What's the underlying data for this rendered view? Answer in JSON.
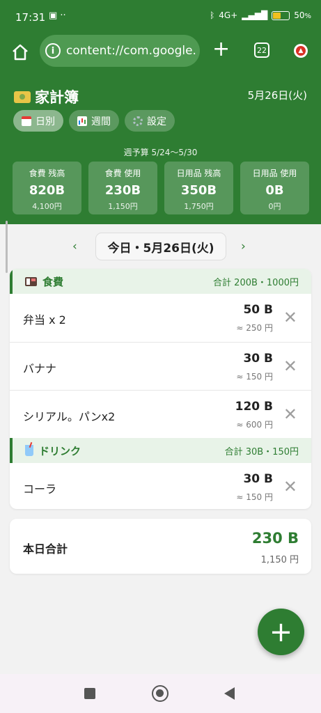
{
  "status_bar": {
    "time": "17:31",
    "notifications": "▣ ··",
    "network": "4G+",
    "battery": "50",
    "battery_unit": "%"
  },
  "browser": {
    "url": "content://com.google.",
    "tab_count": "22"
  },
  "app": {
    "title": "家計簿",
    "date": "5月26日(火)",
    "tabs": [
      {
        "label": "日別",
        "active": true,
        "icon": "calendar-icon"
      },
      {
        "label": "週間",
        "active": false,
        "icon": "chart-icon"
      },
      {
        "label": "設定",
        "active": false,
        "icon": "gear-icon"
      }
    ],
    "budget_period": "週予算 5/24〜5/30",
    "cards": [
      {
        "label": "食費 残高",
        "value": "820B",
        "yen": "4,100円"
      },
      {
        "label": "食費 使用",
        "value": "230B",
        "yen": "1,150円"
      },
      {
        "label": "日用品 残高",
        "value": "350B",
        "yen": "1,750円"
      },
      {
        "label": "日用品 使用",
        "value": "0B",
        "yen": "0円"
      }
    ]
  },
  "date_nav": {
    "prev": "‹",
    "current": "今日・5月26日(火)",
    "next": "›"
  },
  "categories": [
    {
      "name": "食費",
      "icon": "bento-icon",
      "total": "合計 200B・1000円",
      "items": [
        {
          "name": "弁当 x 2",
          "baht": "50 B",
          "yen": "≈ 250 円"
        },
        {
          "name": "バナナ",
          "baht": "30 B",
          "yen": "≈ 150 円"
        },
        {
          "name": "シリアル。パンx2",
          "baht": "120 B",
          "yen": "≈ 600 円"
        }
      ]
    },
    {
      "name": "ドリンク",
      "icon": "drink-icon",
      "total": "合計 30B・150円",
      "items": [
        {
          "name": "コーラ",
          "baht": "30 B",
          "yen": "≈ 150 円"
        }
      ]
    }
  ],
  "total": {
    "label": "本日合計",
    "baht": "230 B",
    "yen": "1,150 円"
  },
  "fab": "+",
  "colors": {
    "primary": "#2e7d32",
    "category_bg": "#e8f3e8",
    "page_bg": "#f2f2f2"
  }
}
